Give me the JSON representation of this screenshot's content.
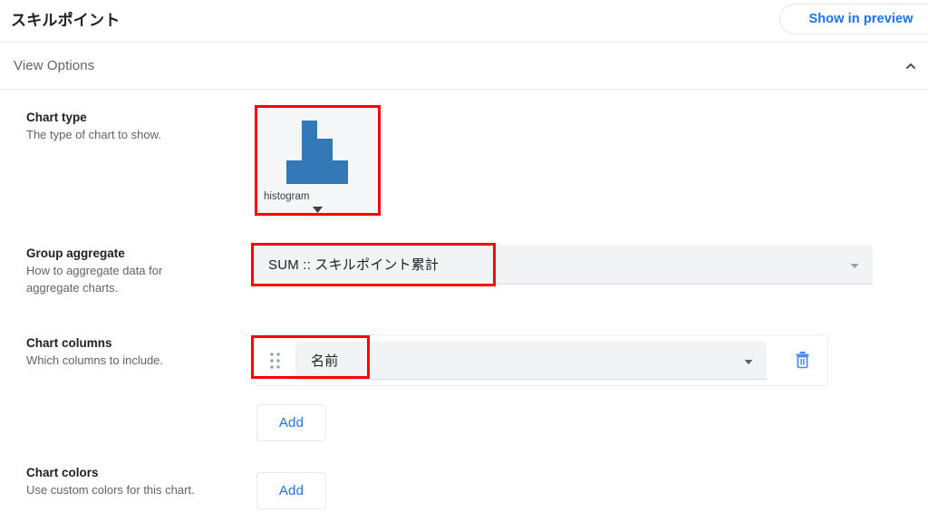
{
  "header": {
    "title": "スキルポイント",
    "preview_button": "Show in preview"
  },
  "section": {
    "title": "View Options",
    "collapse_icon": "chevron-up-icon"
  },
  "rows": {
    "chart_type": {
      "label": "Chart type",
      "description": "The type of chart to show.",
      "card_name": "histogram",
      "card_icon": "histogram-icon",
      "card_caret": "caret-down-icon"
    },
    "group_aggregate": {
      "label": "Group aggregate",
      "description": "How to aggregate data for aggregate charts.",
      "value": "SUM :: スキルポイント累計",
      "caret_icon": "chevron-down-icon"
    },
    "chart_columns": {
      "label": "Chart columns",
      "description": "Which columns to include.",
      "drag_icon": "drag-handle-icon",
      "column_value": "名前",
      "caret_icon": "chevron-down-icon",
      "delete_icon": "trash-icon",
      "add_label": "Add"
    },
    "chart_colors": {
      "label": "Chart colors",
      "description": "Use custom colors for this chart.",
      "add_label": "Add"
    }
  },
  "colors": {
    "accent_blue": "#1a73e8",
    "histogram_blue": "#3479b7",
    "annotation_red": "#ff0000",
    "field_bg": "#f1f3f4",
    "text_primary": "#202124",
    "text_secondary": "#5f6368"
  }
}
